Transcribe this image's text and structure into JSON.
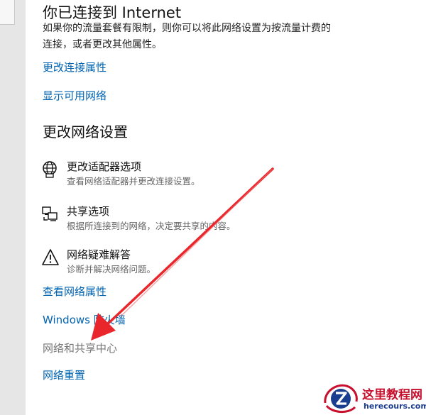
{
  "status": {
    "title": "你已连接到 Internet",
    "description": "如果你的流量套餐有限制，则你可以将此网络设置为按流量计费的连接，或者更改其他属性。",
    "links": [
      "更改连接属性",
      "显示可用网络"
    ]
  },
  "settings": {
    "heading": "更改网络设置",
    "items": [
      {
        "title": "更改适配器选项",
        "subtitle": "查看网络适配器并更改连接设置。",
        "icon": "globe-adapter-icon"
      },
      {
        "title": "共享选项",
        "subtitle": "根据所连接到的网络，决定要共享的内容。",
        "icon": "sharing-icon"
      },
      {
        "title": "网络疑难解答",
        "subtitle": "诊断并解决网络问题。",
        "icon": "warning-icon"
      }
    ]
  },
  "bottom_links": {
    "view_properties": "查看网络属性",
    "firewall": "Windows 防火墙",
    "sharing_center": "网络和共享中心",
    "reset": "网络重置"
  },
  "watermark": {
    "name": "这里教程网",
    "domain": "herecours.com",
    "icon": "z-logo-icon"
  },
  "colors": {
    "link": "#0063b1",
    "arrow": "#e8262b",
    "muted": "#767676"
  }
}
